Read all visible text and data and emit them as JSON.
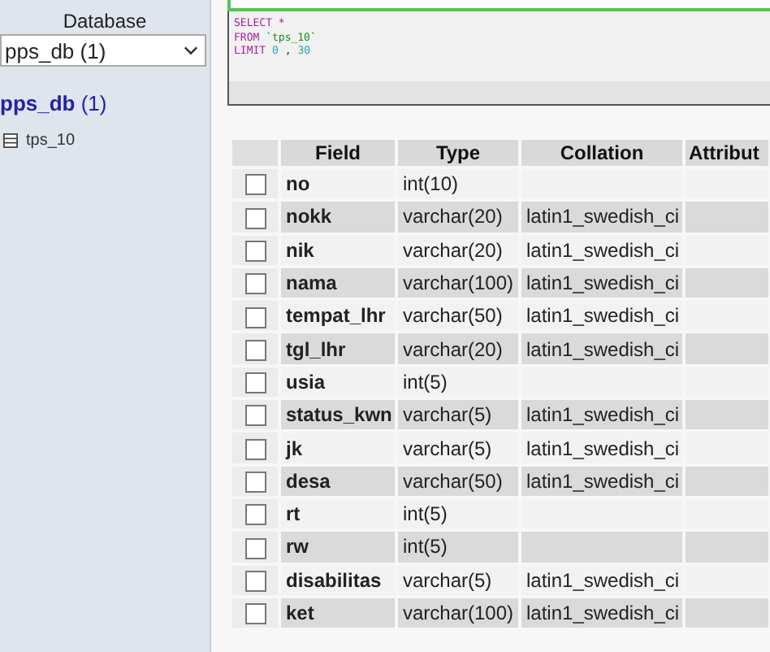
{
  "sidebar": {
    "label": "Database",
    "select": {
      "value": "pps_db (1)"
    },
    "database": {
      "name": "pps_db",
      "count": "(1)"
    },
    "tables": [
      {
        "name": "tps_10"
      }
    ]
  },
  "sql": {
    "lines": [
      [
        {
          "kind": "keyword",
          "text": "SELECT"
        },
        {
          "kind": "keyword",
          "text": "*"
        }
      ],
      [
        {
          "kind": "keyword",
          "text": "FROM"
        },
        {
          "kind": "string",
          "text": "`tps_10`"
        }
      ],
      [
        {
          "kind": "keyword",
          "text": "LIMIT"
        },
        {
          "kind": "number",
          "text": "0"
        },
        {
          "kind": "plain",
          "text": ","
        },
        {
          "kind": "number",
          "text": "30"
        }
      ]
    ]
  },
  "table": {
    "columns": [
      "Field",
      "Type",
      "Collation",
      "Attribut"
    ],
    "rows": [
      {
        "checked": false,
        "cells": [
          "no",
          "int(10)",
          "",
          ""
        ]
      },
      {
        "checked": false,
        "cells": [
          "nokk",
          "varchar(20)",
          "latin1_swedish_ci",
          ""
        ]
      },
      {
        "checked": false,
        "cells": [
          "nik",
          "varchar(20)",
          "latin1_swedish_ci",
          ""
        ]
      },
      {
        "checked": false,
        "cells": [
          "nama",
          "varchar(100)",
          "latin1_swedish_ci",
          ""
        ]
      },
      {
        "checked": false,
        "cells": [
          "tempat_lhr",
          "varchar(50)",
          "latin1_swedish_ci",
          ""
        ]
      },
      {
        "checked": false,
        "cells": [
          "tgl_lhr",
          "varchar(20)",
          "latin1_swedish_ci",
          ""
        ]
      },
      {
        "checked": false,
        "cells": [
          "usia",
          "int(5)",
          "",
          ""
        ]
      },
      {
        "checked": false,
        "cells": [
          "status_kwn",
          "varchar(5)",
          "latin1_swedish_ci",
          ""
        ]
      },
      {
        "checked": false,
        "cells": [
          "jk",
          "varchar(5)",
          "latin1_swedish_ci",
          ""
        ]
      },
      {
        "checked": false,
        "cells": [
          "desa",
          "varchar(50)",
          "latin1_swedish_ci",
          ""
        ]
      },
      {
        "checked": false,
        "cells": [
          "rt",
          "int(5)",
          "",
          ""
        ]
      },
      {
        "checked": false,
        "cells": [
          "rw",
          "int(5)",
          "",
          ""
        ]
      },
      {
        "checked": false,
        "cells": [
          "disabilitas",
          "varchar(5)",
          "latin1_swedish_ci",
          ""
        ]
      },
      {
        "checked": false,
        "cells": [
          "ket",
          "varchar(100)",
          "latin1_swedish_ci",
          ""
        ]
      }
    ]
  }
}
